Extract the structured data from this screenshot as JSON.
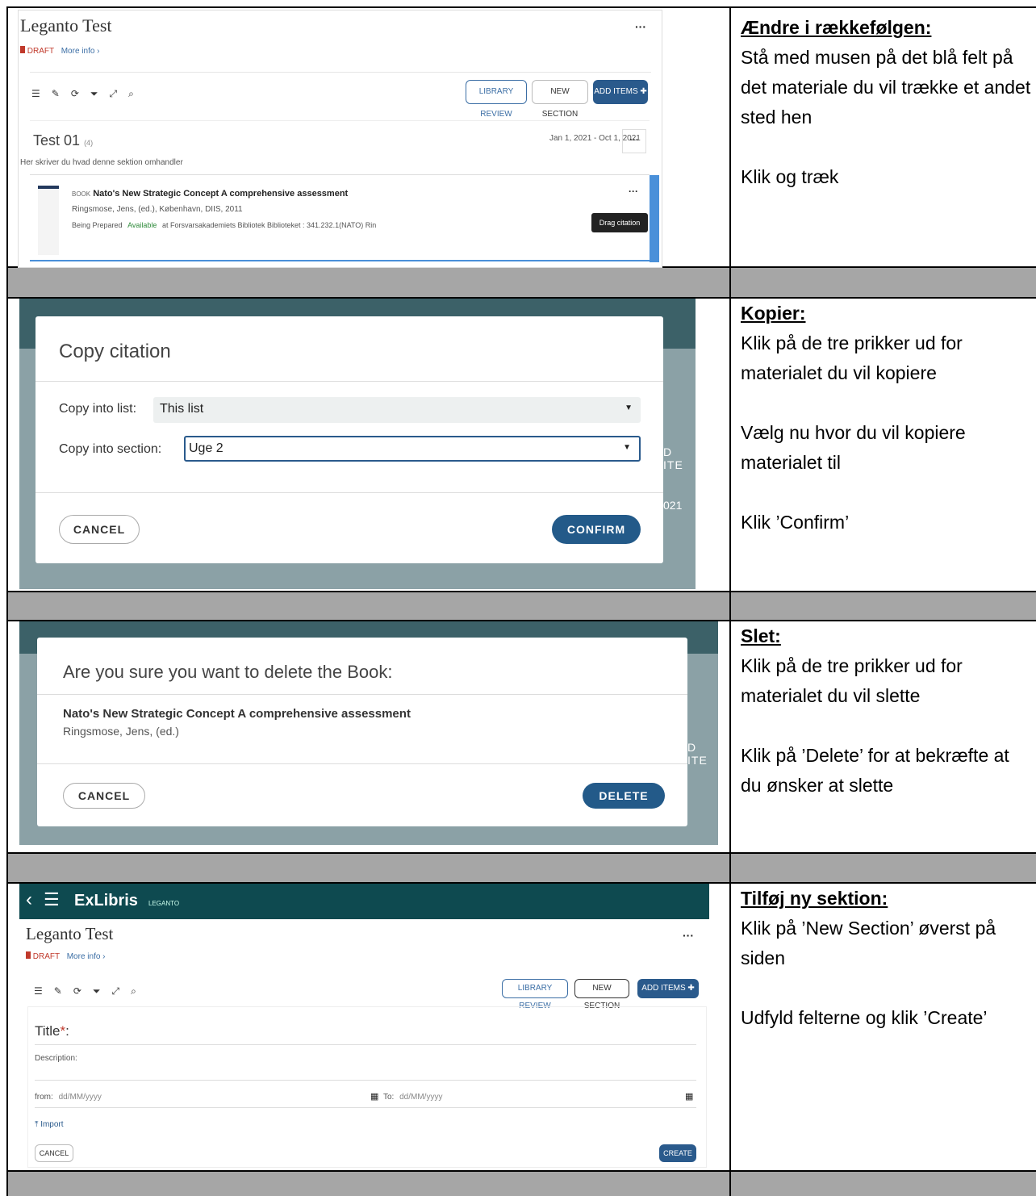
{
  "rows": [
    {
      "heading": "Ændre i rækkefølgen:",
      "paragraphs": [
        "Stå med musen på det blå felt på det materiale du vil trække et andet sted hen",
        "Klik og træk"
      ]
    },
    {
      "heading": "Kopier:",
      "paragraphs": [
        "Klik på de tre prikker ud for materialet du vil kopiere",
        "Vælg nu hvor du vil kopiere materialet til",
        "Klik ’Confirm’"
      ]
    },
    {
      "heading": "Slet:",
      "paragraphs": [
        "Klik på de tre prikker ud for materialet du vil slette",
        "Klik på ’Delete’ for at bekræfte at du ønsker at slette"
      ]
    },
    {
      "heading": "Tilføj ny sektion:",
      "paragraphs": [
        "Klik på ’New Section’ øverst på siden",
        "Udfyld felterne og klik ’Create’"
      ]
    }
  ],
  "shot1": {
    "title": "Leganto Test",
    "draft": "DRAFT",
    "more_info": "More info ›",
    "more": "···",
    "library_review": "LIBRARY REVIEW",
    "new_section": "NEW SECTION",
    "add_items": "ADD ITEMS ✚",
    "section_title": "Test 01",
    "section_count": "(4)",
    "section_dates": "Jan 1, 2021 - Oct 1, 2021",
    "section_desc": "Her skriver du hvad denne sektion omhandler",
    "item_type": "BOOK",
    "item_title": "Nato's New Strategic Concept A comprehensive assessment",
    "item_authors": "Ringsmose, Jens, (ed.), København, DIIS, 2011",
    "item_status_prefix": "Being Prepared",
    "item_available": "Available",
    "item_location": "at Forsvarsakademiets Bibliotek Biblioteket : 341.232.1(NATO) Rin",
    "tooltip": "Drag citation"
  },
  "shot2": {
    "title": "Copy citation",
    "list_label": "Copy into list:",
    "list_value": "This list",
    "section_label": "Copy into section:",
    "section_value": "Uge 2",
    "cancel": "CANCEL",
    "confirm": "CONFIRM",
    "bg_text1": "D ITE",
    "bg_text2": "021"
  },
  "shot3": {
    "title": "Are you sure you want to delete the Book:",
    "book_title": "Nato's New Strategic Concept A comprehensive assessment",
    "book_author": "Ringsmose, Jens, (ed.)",
    "cancel": "CANCEL",
    "delete": "DELETE",
    "bg_text": "D ITE"
  },
  "shot4": {
    "brand": "ExLibris",
    "brand_sub": "LEGANTO",
    "title": "Leganto Test",
    "draft": "DRAFT",
    "more_info": "More info ›",
    "more": "···",
    "library_review": "LIBRARY REVIEW",
    "new_section": "NEW SECTION",
    "add_items": "ADD ITEMS ✚",
    "title_label": "Title",
    "required": "*",
    "title_colon": ":",
    "description_label": "Description:",
    "from_label": "from:",
    "from_placeholder": "dd/MM/yyyy",
    "to_label": "To:",
    "to_placeholder": "dd/MM/yyyy",
    "import": "Import",
    "cancel": "CANCEL",
    "create": "CREATE"
  },
  "colors": {
    "leganto_teal": "#0e4a50",
    "primary_blue": "#2a5a8c",
    "available_green": "#2e8b3a",
    "draft_red": "#c0392b"
  },
  "icons": [
    "list-icon",
    "edit-icon",
    "sync-icon",
    "filter-icon",
    "expand-icon",
    "search-icon",
    "calendar-icon",
    "upload-icon",
    "menu-icon",
    "back-icon"
  ]
}
